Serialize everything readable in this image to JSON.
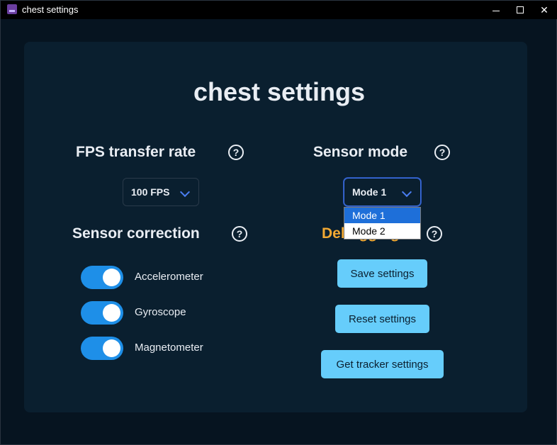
{
  "window": {
    "title": "chest settings"
  },
  "page": {
    "title": "chest settings"
  },
  "fps": {
    "heading": "FPS transfer rate",
    "help": "?",
    "selected": "100 FPS"
  },
  "sensor_mode": {
    "heading": "Sensor mode",
    "help": "?",
    "selected": "Mode 1",
    "options": [
      "Mode 1",
      "Mode 2"
    ]
  },
  "sensor_correction": {
    "heading": "Sensor correction",
    "help": "?",
    "toggles": [
      {
        "label": "Accelerometer",
        "on": true
      },
      {
        "label": "Gyroscope",
        "on": true
      },
      {
        "label": "Magnetometer",
        "on": true
      }
    ]
  },
  "debugging": {
    "heading": "Debugging",
    "help": "?",
    "buttons": [
      "Save settings",
      "Reset settings",
      "Get tracker settings"
    ]
  },
  "colors": {
    "accent": "#1e8fe8",
    "button": "#66cdfb",
    "debugging_heading": "#f2a933"
  }
}
